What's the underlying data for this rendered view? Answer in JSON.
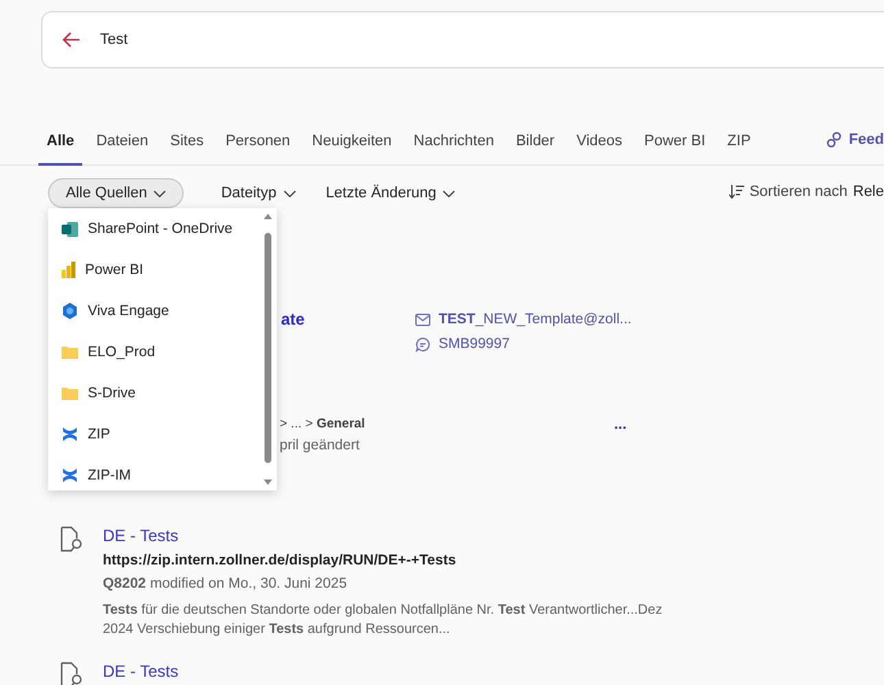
{
  "search": {
    "value": "Test"
  },
  "tabs": [
    {
      "label": "Alle",
      "selected": true
    },
    {
      "label": "Dateien",
      "selected": false
    },
    {
      "label": "Sites",
      "selected": false
    },
    {
      "label": "Personen",
      "selected": false
    },
    {
      "label": "Neuigkeiten",
      "selected": false
    },
    {
      "label": "Nachrichten",
      "selected": false
    },
    {
      "label": "Bilder",
      "selected": false
    },
    {
      "label": "Videos",
      "selected": false
    },
    {
      "label": "Power BI",
      "selected": false
    },
    {
      "label": "ZIP",
      "selected": false
    }
  ],
  "feedback": {
    "label": "Feed"
  },
  "filters": [
    {
      "label": "Alle Quellen",
      "selected": true
    },
    {
      "label": "Dateityp",
      "selected": false
    },
    {
      "label": "Letzte Änderung",
      "selected": false
    }
  ],
  "sort": {
    "label": "Sortieren nach",
    "value": "Rele"
  },
  "source_menu": {
    "items": [
      {
        "label": "SharePoint - OneDrive",
        "kind": "sharepoint"
      },
      {
        "label": "Power BI",
        "kind": "powerbi"
      },
      {
        "label": "Viva Engage",
        "kind": "viva"
      },
      {
        "label": "ELO_Prod",
        "kind": "folder"
      },
      {
        "label": "S-Drive",
        "kind": "folder"
      },
      {
        "label": "ZIP",
        "kind": "zip"
      },
      {
        "label": "ZIP-IM",
        "kind": "zip"
      }
    ]
  },
  "results": [
    {
      "kind": "partial_contact",
      "title": "ate",
      "email": "**TEST**_NEW_Template@zoll...",
      "chat": "SMB99997"
    },
    {
      "kind": "partial_path",
      "more": "...",
      "breadcrumb": "> ... > **General**",
      "modified": "pril geändert"
    },
    {
      "kind": "page",
      "title": "DE - Tests",
      "url": "https://zip.intern.zollner.de/display/RUN/DE+-+Tests",
      "modified": "**Q8202** modified on Mo., 30. Juni 2025",
      "snippet": "**Tests** für die deutschen Standorte oder globalen Notfallpläne Nr. **Test** Verantwortlicher...Dez 2024 Verschiebung einiger **Tests** aufgrund Ressourcen..."
    },
    {
      "kind": "page",
      "title": "DE - Tests"
    }
  ]
}
